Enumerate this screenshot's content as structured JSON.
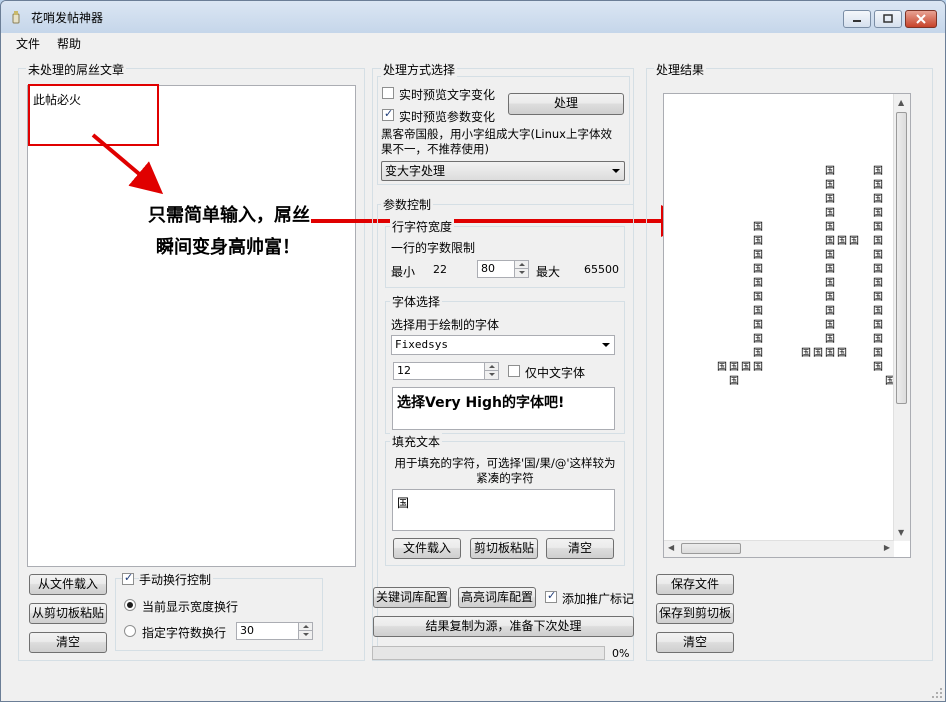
{
  "window": {
    "title": "花哨发帖神器"
  },
  "menu": [
    "文件",
    "帮助"
  ],
  "left": {
    "group_title": "未处理的屌丝文章",
    "input_text": "此帖必火",
    "load_file": "从文件载入",
    "paste_clipboard": "从剪切板粘贴",
    "clear": "清空",
    "manual_wrap": "手动换行控制",
    "wrap_current": "当前显示宽度换行",
    "wrap_by_count": "指定字符数换行",
    "wrap_count_value": "30"
  },
  "annotation": {
    "line1": "只需简单输入，屌丝",
    "line2": "瞬间变身高帅富！"
  },
  "middle": {
    "method_title": "处理方式选择",
    "preview_text_change": "实时预览文字变化",
    "preview_param_change": "实时预览参数变化",
    "process_button": "处理",
    "description": "黑客帝国般，用小字组成大字(Linux上字体效果不一，不推荐使用)",
    "mode_selected": "变大字处理",
    "param_title": "参数控制",
    "row_width_title": "行字符宽度",
    "row_limit_label": "一行的字数限制",
    "min_label": "最小",
    "min_value": "22",
    "current_value": "80",
    "max_label": "最大",
    "max_value": "65500",
    "font_title": "字体选择",
    "font_select_label": "选择用于绘制的字体",
    "font_name": "Fixedsys",
    "font_size": "12",
    "chinese_only": "仅中文字体",
    "font_preview": "选择Very High的字体吧!",
    "fill_title": "填充文本",
    "fill_desc": "用于填充的字符，可选择'国/果/@'这样较为紧凑的字符",
    "fill_char": "国",
    "fill_load_file": "文件载入",
    "fill_paste": "剪切板粘贴",
    "fill_clear": "清空",
    "keyword_config": "关键词库配置",
    "highlight_config": "高亮词库配置",
    "add_promo": "添加推广标记",
    "copy_result": "结果复制为源，准备下次处理",
    "progress": 0,
    "progress_label": "0%"
  },
  "right": {
    "group_title": "处理结果",
    "save_file": "保存文件",
    "save_clipboard": "保存到剪切板",
    "clear": "清空",
    "art_char": "国"
  },
  "colors": {
    "accent": "#e00000",
    "window_bg": "#f0f0f0",
    "progress": "#06b025"
  }
}
